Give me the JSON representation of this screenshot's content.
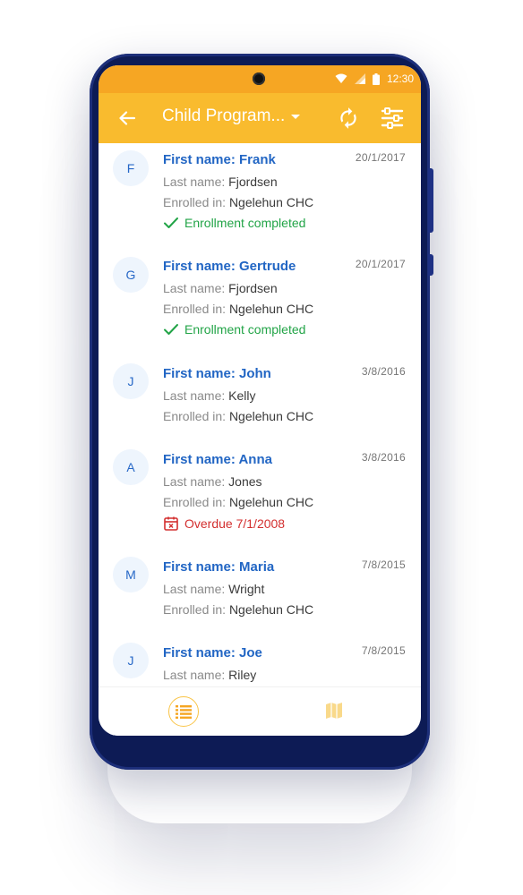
{
  "status_bar": {
    "time": "12:30",
    "icons": [
      "wifi-icon",
      "signal-icon",
      "battery-icon"
    ]
  },
  "app_bar": {
    "title": "Child Program...",
    "back_icon": "arrow-left-icon",
    "dropdown_icon": "caret-down-icon",
    "sync_icon": "sync-icon",
    "filter_icon": "filter-sliders-icon"
  },
  "list": {
    "last_name_label": "Last name:",
    "enrolled_label": "Enrolled in:",
    "items": [
      {
        "initial": "F",
        "first_name": "First name: Frank",
        "date": "20/1/2017",
        "last_name": "Fjordsen",
        "enrolled_in": "Ngelehun CHC",
        "status": "Enrollment completed",
        "status_type": "completed"
      },
      {
        "initial": "G",
        "first_name": "First name: Gertrude",
        "date": "20/1/2017",
        "last_name": "Fjordsen",
        "enrolled_in": "Ngelehun CHC",
        "status": "Enrollment completed",
        "status_type": "completed"
      },
      {
        "initial": "J",
        "first_name": "First name: John",
        "date": "3/8/2016",
        "last_name": "Kelly",
        "enrolled_in": "Ngelehun CHC",
        "status": "",
        "status_type": "none"
      },
      {
        "initial": "A",
        "first_name": "First name: Anna",
        "date": "3/8/2016",
        "last_name": "Jones",
        "enrolled_in": "Ngelehun CHC",
        "status": "Overdue 7/1/2008",
        "status_type": "overdue"
      },
      {
        "initial": "M",
        "first_name": "First name: Maria",
        "date": "7/8/2015",
        "last_name": "Wright",
        "enrolled_in": "Ngelehun CHC",
        "status": "",
        "status_type": "none"
      },
      {
        "initial": "J",
        "first_name": "First name: Joe",
        "date": "7/8/2015",
        "last_name": "Riley",
        "enrolled_in": "",
        "status": "",
        "status_type": "none"
      }
    ]
  },
  "bottom_nav": {
    "items": [
      {
        "icon": "list-icon",
        "selected": true
      },
      {
        "icon": "map-icon",
        "selected": false
      }
    ]
  },
  "colors": {
    "primary": "#f9bb2e",
    "status_bar": "#f6a623",
    "link_blue": "#2266c4",
    "completed_green": "#22a447",
    "overdue_red": "#d32f2f",
    "phone_body": "#0d1b55"
  }
}
